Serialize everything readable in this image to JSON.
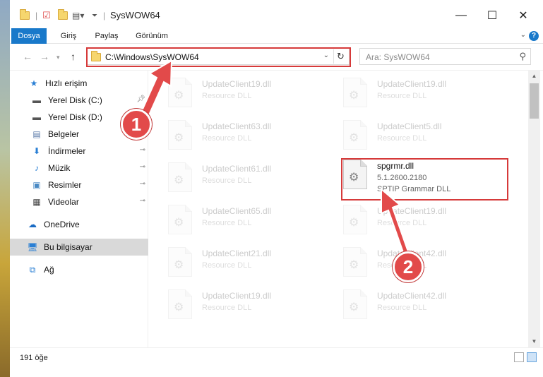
{
  "window": {
    "title": "SysWOW64",
    "controls": {
      "minimize": "—",
      "maximize": "☐",
      "close": "✕"
    }
  },
  "ribbon": {
    "tabs": [
      "Dosya",
      "Giriş",
      "Paylaş",
      "Görünüm"
    ],
    "help": "?"
  },
  "navigation": {
    "address_path": "C:\\Windows\\SysWOW64",
    "search_placeholder": "Ara: SysWOW64"
  },
  "sidebar": {
    "items": [
      {
        "label": "Hızlı erişim",
        "icon": "star-icon",
        "pinned": false
      },
      {
        "label": "Yerel Disk (C:)",
        "icon": "drive-icon",
        "pinned": true
      },
      {
        "label": "Yerel Disk (D:)",
        "icon": "drive-icon",
        "pinned": false
      },
      {
        "label": "Belgeler",
        "icon": "documents-icon",
        "pinned": true
      },
      {
        "label": "İndirmeler",
        "icon": "download-icon",
        "pinned": true
      },
      {
        "label": "Müzik",
        "icon": "music-icon",
        "pinned": true
      },
      {
        "label": "Resimler",
        "icon": "pictures-icon",
        "pinned": true
      },
      {
        "label": "Videolar",
        "icon": "video-icon",
        "pinned": true
      },
      {
        "label": "OneDrive",
        "icon": "cloud-icon",
        "pinned": false
      },
      {
        "label": "Bu bilgisayar",
        "icon": "computer-icon",
        "pinned": false,
        "selected": true
      },
      {
        "label": "Ağ",
        "icon": "network-icon",
        "pinned": false
      }
    ]
  },
  "files": [
    {
      "name": "UpdateClient19.dll",
      "type": "Resource DLL",
      "faded": true
    },
    {
      "name": "UpdateClient19.dll",
      "type": "Resource DLL",
      "faded": true
    },
    {
      "name": "UpdateClient63.dll",
      "type": "Resource DLL",
      "faded": true
    },
    {
      "name": "UpdateClient5.dll",
      "type": "Resource DLL",
      "faded": true
    },
    {
      "name": "UpdateClient61.dll",
      "type": "Resource DLL",
      "faded": true
    },
    {
      "name": "spgrmr.dll",
      "version": "5.1.2600.2180",
      "type": "SPTIP Grammar DLL",
      "faded": false,
      "highlighted": true
    },
    {
      "name": "UpdateClient65.dll",
      "type": "Resource DLL",
      "faded": true
    },
    {
      "name": "UpdateClient19.dll",
      "type": "Resource DLL",
      "faded": true
    },
    {
      "name": "UpdateClient21.dll",
      "type": "Resource DLL",
      "faded": true
    },
    {
      "name": "UpdateClient42.dll",
      "type": "Resource DLL",
      "faded": true
    },
    {
      "name": "UpdateClient19.dll",
      "type": "Resource DLL",
      "faded": true
    },
    {
      "name": "UpdateClient42.dll",
      "type": "Resource DLL",
      "faded": true
    }
  ],
  "status": {
    "item_count": "191 öğe"
  },
  "annotations": [
    {
      "label": "1",
      "color": "#e24a4a"
    },
    {
      "label": "2",
      "color": "#e24a4a"
    }
  ]
}
